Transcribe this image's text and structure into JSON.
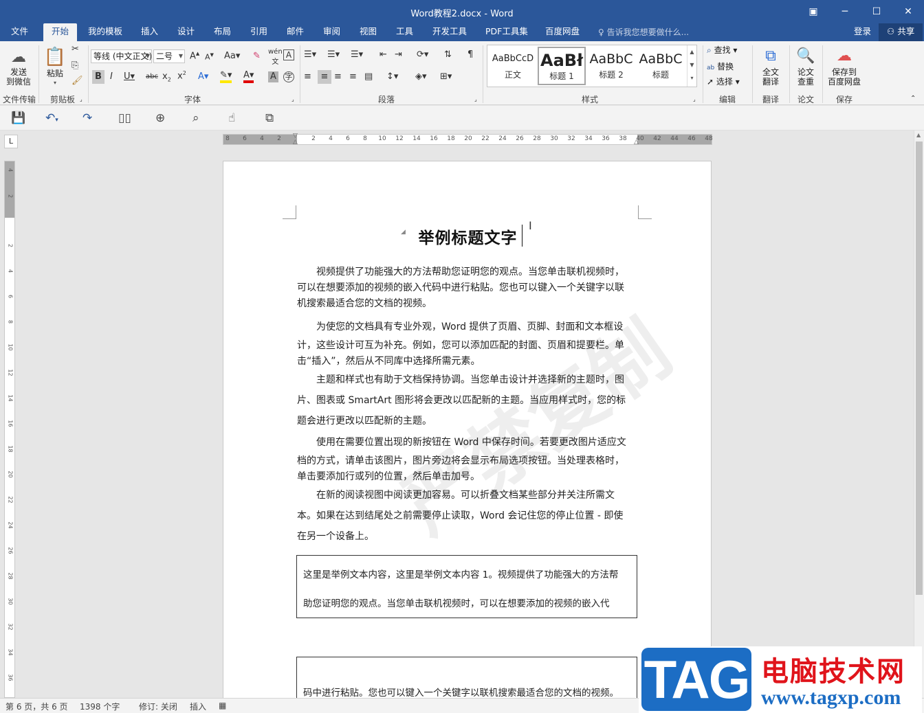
{
  "window": {
    "title": "Word教程2.docx - Word"
  },
  "menu": {
    "tabs": [
      "文件",
      "开始",
      "我的模板",
      "插入",
      "设计",
      "布局",
      "引用",
      "邮件",
      "审阅",
      "视图",
      "工具",
      "开发工具",
      "PDF工具集",
      "百度网盘"
    ],
    "active": "开始",
    "tell_me": "告诉我您想要做什么...",
    "login": "登录",
    "share": "共享"
  },
  "ribbon": {
    "groups": {
      "send": "文件传输",
      "clipboard": "剪贴板",
      "font": "字体",
      "paragraph": "段落",
      "styles": "样式",
      "editing": "编辑",
      "translate": "翻译",
      "paper": "论文",
      "save": "保存"
    },
    "send_wechat": "发送\n到微信",
    "paste": "粘贴",
    "font_name": "等线 (中文正文)",
    "font_size": "二号",
    "style_items": [
      {
        "preview": "AaBbCcD",
        "label": "正文"
      },
      {
        "preview": "AaBł",
        "label": "标题 1"
      },
      {
        "preview": "AaBbC",
        "label": "标题 2"
      },
      {
        "preview": "AaBbC",
        "label": "标题"
      }
    ],
    "find": "查找",
    "replace": "替换",
    "select": "选择",
    "full_translate": "全文\n翻译",
    "paper_check": "论文\n查重",
    "save_baidu": "保存到\n百度网盘"
  },
  "ruler": {
    "h_left": [
      "8",
      "6",
      "4",
      "2"
    ],
    "h_right": [
      "2",
      "4",
      "6",
      "8",
      "10",
      "12",
      "14",
      "16",
      "18",
      "20",
      "22",
      "24",
      "26",
      "28",
      "30",
      "32",
      "34",
      "36",
      "38",
      "40",
      "42",
      "44",
      "46",
      "48"
    ],
    "v": [
      "4",
      "2",
      "2",
      "4",
      "6",
      "8",
      "10",
      "12",
      "14",
      "16",
      "18",
      "20",
      "22",
      "24",
      "26",
      "28",
      "30",
      "32",
      "34",
      "36"
    ]
  },
  "document": {
    "title": "举例标题文字",
    "paragraphs": [
      [
        "视频提供了功能强大的方法帮助您证明您的观点。当您单击联机视频时，",
        "可以在想要添加的视频的嵌入代码中进行粘贴。您也可以键入一个关键字以联",
        "机搜索最适合您的文档的视频。"
      ],
      [
        "为使您的文档具有专业外观，Word 提供了页眉、页脚、封面和文本框设",
        "计，这些设计可互为补充。例如，您可以添加匹配的封面、页眉和提要栏。单",
        "击“插入”，然后从不同库中选择所需元素。"
      ],
      [
        "主题和样式也有助于文档保持协调。当您单击设计并选择新的主题时，图",
        "片、图表或 SmartArt 图形将会更改以匹配新的主题。当应用样式时，您的标",
        "题会进行更改以匹配新的主题。"
      ],
      [
        "使用在需要位置出现的新按钮在 Word 中保存时间。若要更改图片适应文",
        "档的方式，请单击该图片，图片旁边将会显示布局选项按钮。当处理表格时，",
        "单击要添加行或列的位置，然后单击加号。"
      ],
      [
        "在新的阅读视图中阅读更加容易。可以折叠文档某些部分并关注所需文",
        "本。如果在达到结尾处之前需要停止读取，Word 会记住您的停止位置 - 即使",
        "在另一个设备上。"
      ]
    ],
    "textbox1": [
      "这里是举例文本内容，这里是举例文本内容 1。视频提供了功能强大的方法帮",
      "助您证明您的观点。当您单击联机视频时，可以在想要添加的视频的嵌入代"
    ],
    "textbox2": [
      "码中进行粘贴。您也可以键入一个关键字以联机搜索最适合您的文档的视频。"
    ],
    "watermark": "严禁复制"
  },
  "status": {
    "page": "第 6 页，共 6 页",
    "words": "1398 个字",
    "track": "修订: 关闭",
    "mode": "插入"
  },
  "logo": {
    "tag": "TAG",
    "cn": "电脑技术网",
    "url": "www.tagxp.com"
  }
}
